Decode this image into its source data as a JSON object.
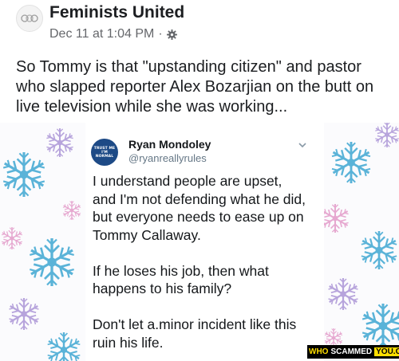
{
  "post": {
    "page_name": "Feminists United",
    "timestamp": "Dec 11 at 1:04 PM",
    "separator": "·",
    "privacy_icon": "gear-icon",
    "text_lines": [
      "So Tommy is that \"upstanding citizen\" and pastor",
      "who slapped reporter Alex Bozarjian on the butt on",
      "live television while she was working..."
    ]
  },
  "tweet": {
    "avatar_lines": [
      "TRUST ME",
      "I'M",
      "NORMAL"
    ],
    "name": "Ryan Mondoley",
    "handle": "@ryanreallyrules",
    "menu_icon": "chevron-down-icon",
    "paragraphs": [
      [
        "I understand people are upset,",
        "and I'm not defending what he did,",
        "but everyone needs to ease up on",
        "Tommy Callaway."
      ],
      [
        "If he loses his job, then what",
        "happens to his family?"
      ],
      [
        "Don't let a.minor incident like this",
        "ruin his life."
      ]
    ]
  },
  "watermark": {
    "part1": "WHO",
    "part2": "SCAMMED",
    "part3": "YOU.COM"
  },
  "colors": {
    "snowflake_blue": "#5ab3d8",
    "snowflake_purple": "#b7a4dc",
    "snowflake_pink": "#e6a8d0",
    "meta_gray": "#65676b"
  }
}
